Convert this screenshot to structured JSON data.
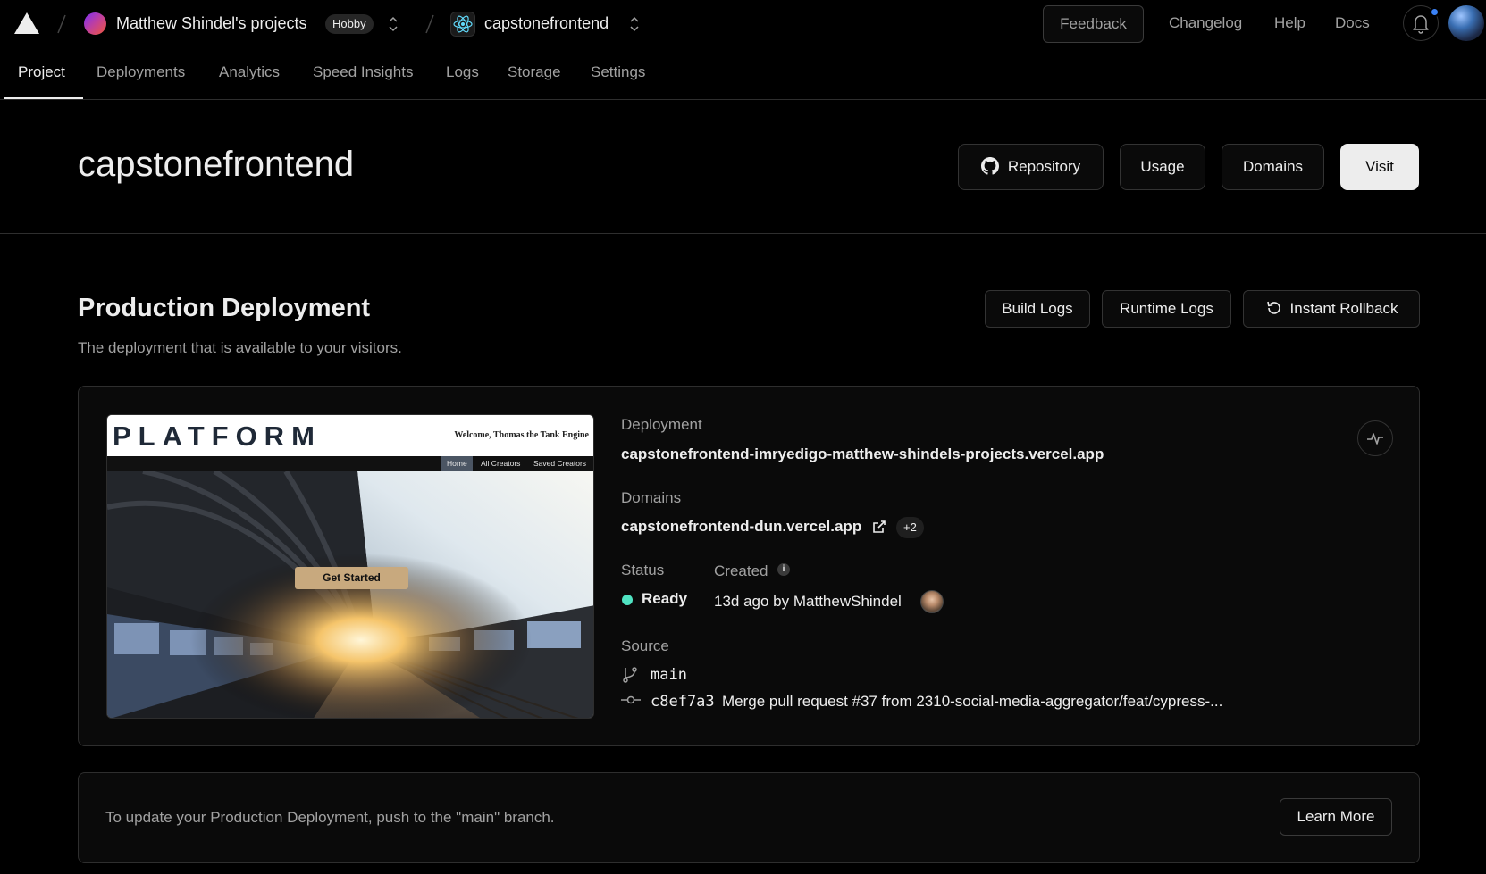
{
  "topbar": {
    "team_name": "Matthew Shindel's projects",
    "plan_badge": "Hobby",
    "project_name": "capstonefrontend",
    "feedback_label": "Feedback",
    "links": [
      "Changelog",
      "Help",
      "Docs"
    ]
  },
  "tabs": [
    {
      "label": "Project",
      "active": true
    },
    {
      "label": "Deployments"
    },
    {
      "label": "Analytics"
    },
    {
      "label": "Speed Insights"
    },
    {
      "label": "Logs"
    },
    {
      "label": "Storage"
    },
    {
      "label": "Settings"
    }
  ],
  "header": {
    "title": "capstonefrontend",
    "buttons": {
      "repository": "Repository",
      "usage": "Usage",
      "domains": "Domains",
      "visit": "Visit"
    }
  },
  "production": {
    "title": "Production Deployment",
    "subtitle": "The deployment that is available to your visitors.",
    "buttons": {
      "build_logs": "Build Logs",
      "runtime_logs": "Runtime Logs",
      "instant_rollback": "Instant Rollback"
    },
    "preview": {
      "brand": "PLATFORM",
      "welcome": "Welcome, Thomas the Tank Engine",
      "nav": [
        "Home",
        "All Creators",
        "Saved Creators"
      ],
      "cta": "Get Started"
    },
    "deployment_label": "Deployment",
    "deployment_url": "capstonefrontend-imryedigo-matthew-shindels-projects.vercel.app",
    "domains_label": "Domains",
    "domain": "capstonefrontend-dun.vercel.app",
    "domains_more": "+2",
    "status_label": "Status",
    "status_value": "Ready",
    "created_label": "Created",
    "created_value": "13d ago by MatthewShindel",
    "source_label": "Source",
    "branch": "main",
    "commit_hash": "c8ef7a3",
    "commit_message": "Merge pull request #37 from 2310-social-media-aggregator/feat/cypress-..."
  },
  "footer": {
    "text": "To update your Production Deployment, push to the \"main\" branch.",
    "button": "Learn More"
  },
  "colors": {
    "background": "#000000",
    "text": "#ededed",
    "muted": "#a1a1a1",
    "border": "#2e2e2e",
    "ready": "#50e3c2",
    "notification": "#3b82f6"
  }
}
